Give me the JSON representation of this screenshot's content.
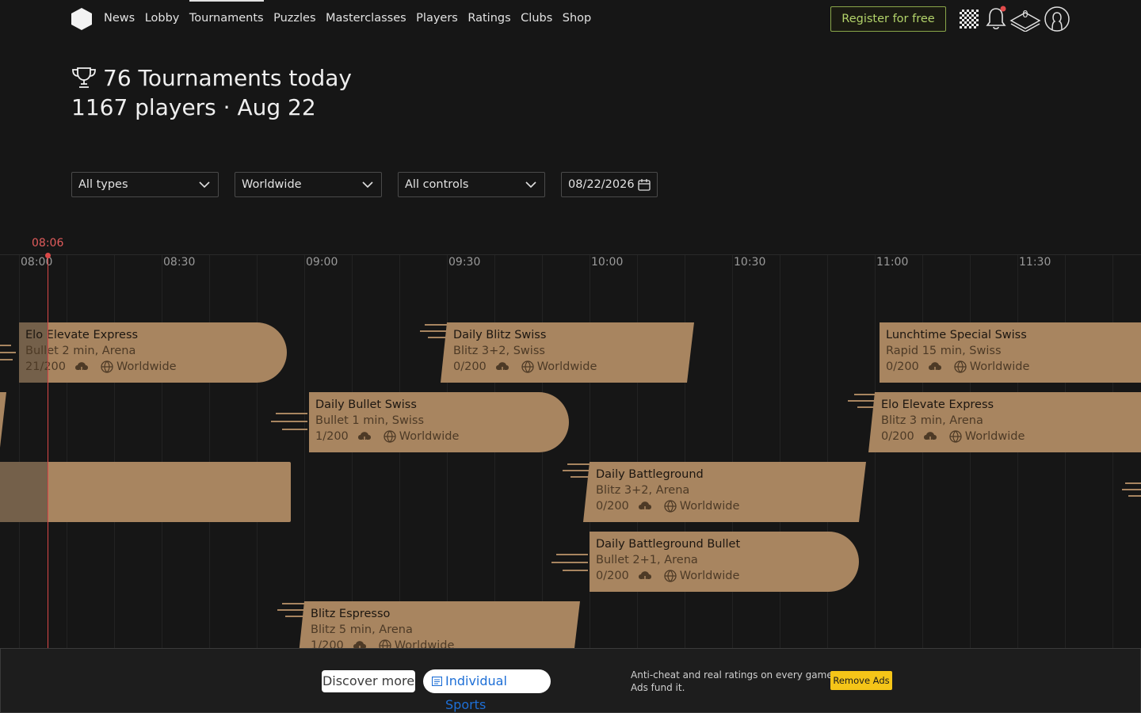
{
  "nav": {
    "links": [
      "News",
      "Lobby",
      "Tournaments",
      "Puzzles",
      "Masterclasses",
      "Players",
      "Ratings",
      "Clubs",
      "Shop"
    ],
    "register_label": "Register for free",
    "notifications_count": "0"
  },
  "header": {
    "title": "76 Tournaments today",
    "subtitle": "1167 players · Aug 22"
  },
  "filters": {
    "type": "All types",
    "region": "Worldwide",
    "control": "All controls",
    "date": "08/22/2026"
  },
  "timeline": {
    "now_label": "08:06",
    "ticks": [
      "08:00",
      "08:30",
      "09:00",
      "09:30",
      "10:00",
      "10:30",
      "11:00",
      "11:30"
    ]
  },
  "tournaments": [
    {
      "name": "Elo Elevate Express",
      "desc": "Bullet 2 min, Arena",
      "players": "21/200",
      "region": "Worldwide"
    },
    {
      "name": "Daily Blitz Swiss",
      "desc": "Blitz 3+2, Swiss",
      "players": "0/200",
      "region": "Worldwide"
    },
    {
      "name": "Lunchtime Special Swiss",
      "desc": "Rapid 15 min, Swiss",
      "players": "0/200",
      "region": "Worldwide"
    },
    {
      "name": "Daily Bullet Swiss",
      "desc": "Bullet 1 min, Swiss",
      "players": "1/200",
      "region": "Worldwide"
    },
    {
      "name": "Elo Elevate Express",
      "desc": "Blitz 3 min, Arena",
      "players": "0/200",
      "region": "Worldwide"
    },
    {
      "name": "Daily Battleground",
      "desc": "Blitz 3+2, Arena",
      "players": "0/200",
      "region": "Worldwide"
    },
    {
      "name": "Daily Battleground Bullet",
      "desc": "Bullet 2+1, Arena",
      "players": "0/200",
      "region": "Worldwide"
    },
    {
      "name": "Blitz Espresso",
      "desc": "Blitz 5 min, Arena",
      "players": "1/200",
      "region": "Worldwide"
    }
  ],
  "ad": {
    "discover_label": "Discover more",
    "sports_label": "Individual Sports",
    "text_line1": "Anti-cheat and real ratings on every game.",
    "text_line2": "Ads fund it.",
    "remove_label": "Remove Ads"
  },
  "colors": {
    "background": "#161616",
    "card": "#a88560",
    "card_past": "#74604a",
    "now_line": "#d94848",
    "register_border": "#8aa74a",
    "remove_ads_bg": "#f5c518"
  }
}
